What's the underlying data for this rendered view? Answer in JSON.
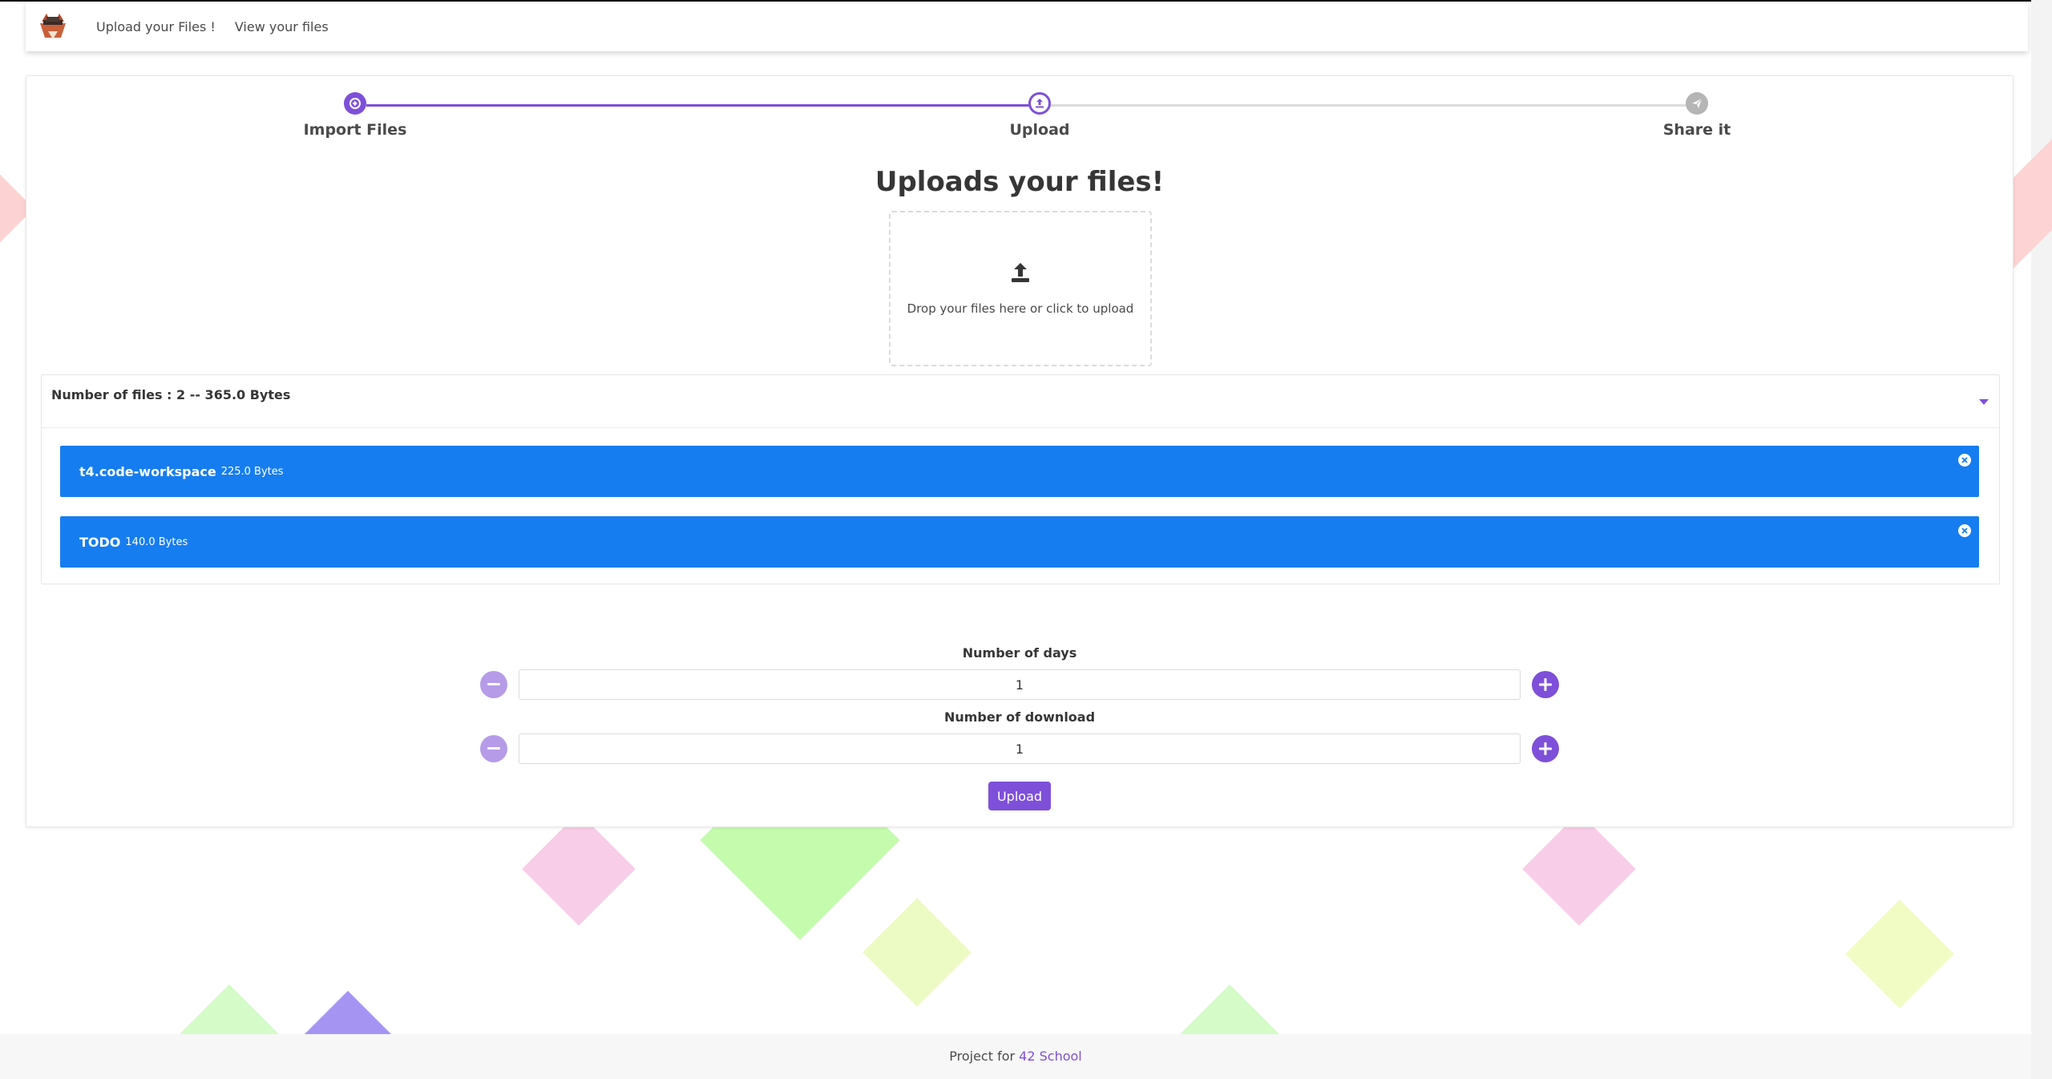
{
  "navbar": {
    "logo": "fox-logo-icon",
    "links": [
      "Upload your Files !",
      "View your files"
    ]
  },
  "steps": [
    {
      "label": "Import Files",
      "icon": "import-icon",
      "state": "done"
    },
    {
      "label": "Upload",
      "icon": "upload-icon",
      "state": "active"
    },
    {
      "label": "Share it",
      "icon": "paper-plane-icon",
      "state": "pending"
    }
  ],
  "main": {
    "title": "Uploads your files!",
    "dropzone_text": "Drop your files here or click to upload"
  },
  "files": {
    "summary": "Number of files : 2 -- 365.0 Bytes",
    "items": [
      {
        "name": "t4.code-workspace",
        "size": "225.0 Bytes"
      },
      {
        "name": "TODO",
        "size": "140.0 Bytes"
      }
    ]
  },
  "fields": {
    "days_label": "Number of days",
    "days_value": "1",
    "download_label": "Number of download",
    "download_value": "1"
  },
  "upload_label": "Upload",
  "footer": {
    "prefix": "Project for",
    "link": "42 School"
  },
  "colors": {
    "accent": "#7e50d9",
    "file_item": "#167df0",
    "minus_button": "#b59be8"
  }
}
